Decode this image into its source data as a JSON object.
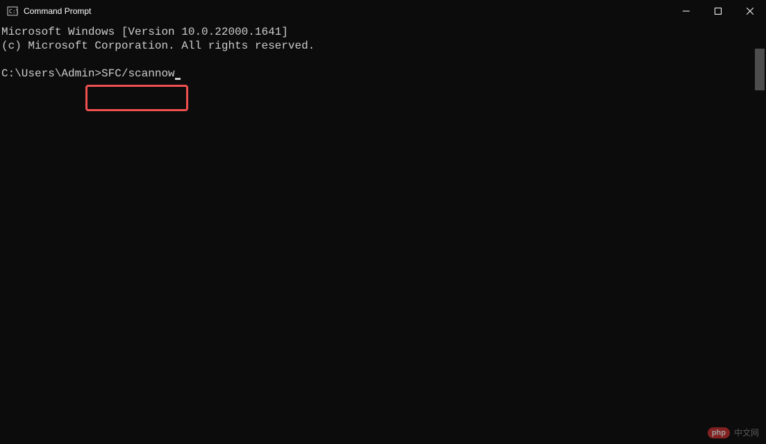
{
  "titlebar": {
    "title": "Command Prompt"
  },
  "terminal": {
    "line1": "Microsoft Windows [Version 10.0.22000.1641]",
    "line2": "(c) Microsoft Corporation. All rights reserved.",
    "prompt": "C:\\Users\\Admin>",
    "command": "SFC/scannow"
  },
  "watermark": {
    "badge": "php",
    "text": "中文网"
  }
}
